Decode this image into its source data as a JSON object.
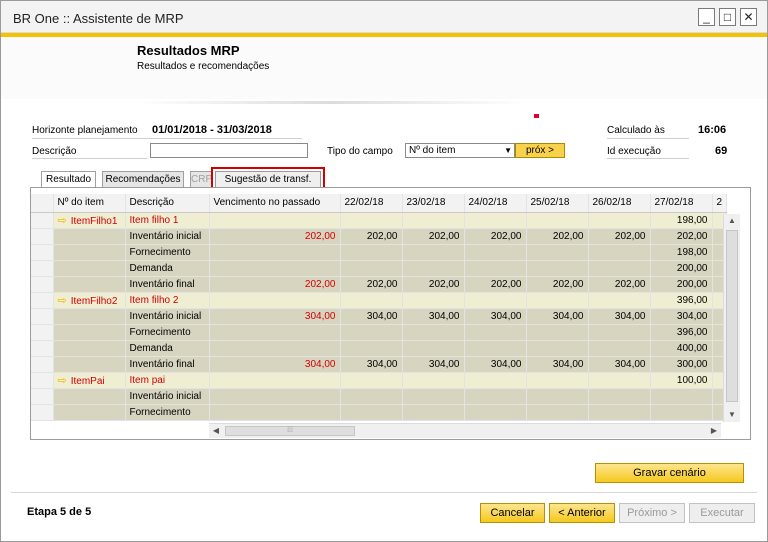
{
  "window": {
    "title": "BR One :: Assistente de MRP",
    "controls": {
      "minimize": "_",
      "maximize": "□",
      "close": "✕"
    }
  },
  "header": {
    "title": "Resultados MRP",
    "subtitle": "Resultados e recomendações"
  },
  "form": {
    "horizonte_label": "Horizonte planejamento",
    "horizonte_value": "01/01/2018 - 31/03/2018",
    "descricao_label": "Descrição",
    "descricao_value": "",
    "tipo_campo_label": "Tipo do campo",
    "tipo_campo_value": "Nº do item",
    "prox_button": "próx >",
    "calculado_label": "Calculado às",
    "calculado_value": "16:06",
    "id_execucao_label": "Id execução",
    "id_execucao_value": "69"
  },
  "tabs": [
    "Resultado",
    "Recomendações",
    "CRP",
    "Sugestão de transf."
  ],
  "grid": {
    "columns": [
      "Nº do item",
      "Descrição",
      "Vencimento no passado",
      "22/02/18",
      "23/02/18",
      "24/02/18",
      "25/02/18",
      "26/02/18",
      "27/02/18",
      "2"
    ],
    "rows": [
      {
        "type": "item",
        "item": "ItemFilho1",
        "desc": "Item filho 1",
        "past": "",
        "v": [
          "",
          "",
          "",
          "",
          "",
          "198,00"
        ]
      },
      {
        "type": "sub",
        "item": "",
        "desc": "Inventário inicial",
        "past": "202,00",
        "v": [
          "202,00",
          "202,00",
          "202,00",
          "202,00",
          "202,00",
          "202,00"
        ]
      },
      {
        "type": "sub",
        "item": "",
        "desc": "Fornecimento",
        "past": "",
        "v": [
          "",
          "",
          "",
          "",
          "",
          "198,00"
        ]
      },
      {
        "type": "sub",
        "item": "",
        "desc": "Demanda",
        "past": "",
        "v": [
          "",
          "",
          "",
          "",
          "",
          "200,00"
        ]
      },
      {
        "type": "sub",
        "item": "",
        "desc": "Inventário final",
        "past": "202,00",
        "v": [
          "202,00",
          "202,00",
          "202,00",
          "202,00",
          "202,00",
          "200,00"
        ]
      },
      {
        "type": "item",
        "item": "ItemFilho2",
        "desc": "Item filho 2",
        "past": "",
        "v": [
          "",
          "",
          "",
          "",
          "",
          "396,00"
        ]
      },
      {
        "type": "sub",
        "item": "",
        "desc": "Inventário inicial",
        "past": "304,00",
        "v": [
          "304,00",
          "304,00",
          "304,00",
          "304,00",
          "304,00",
          "304,00"
        ]
      },
      {
        "type": "sub",
        "item": "",
        "desc": "Fornecimento",
        "past": "",
        "v": [
          "",
          "",
          "",
          "",
          "",
          "396,00"
        ]
      },
      {
        "type": "sub",
        "item": "",
        "desc": "Demanda",
        "past": "",
        "v": [
          "",
          "",
          "",
          "",
          "",
          "400,00"
        ]
      },
      {
        "type": "sub",
        "item": "",
        "desc": "Inventário final",
        "past": "304,00",
        "v": [
          "304,00",
          "304,00",
          "304,00",
          "304,00",
          "304,00",
          "300,00"
        ]
      },
      {
        "type": "item",
        "item": "ItemPai",
        "desc": "Item pai",
        "past": "",
        "v": [
          "",
          "",
          "",
          "",
          "",
          "100,00"
        ]
      },
      {
        "type": "sub",
        "item": "",
        "desc": "Inventário inicial",
        "past": "",
        "v": [
          "",
          "",
          "",
          "",
          "",
          ""
        ]
      },
      {
        "type": "sub",
        "item": "",
        "desc": "Fornecimento",
        "past": "",
        "v": [
          "",
          "",
          "",
          "",
          "",
          ""
        ]
      }
    ]
  },
  "buttons": {
    "gravar": "Gravar cenário",
    "cancelar": "Cancelar",
    "anterior": "< Anterior",
    "proximo": "Próximo >",
    "executar": "Executar"
  },
  "footer": {
    "step": "Etapa 5 de 5"
  },
  "colors": {
    "accent": "#f5c200",
    "highlight": "#d40000",
    "item_row": "#efedd2",
    "sub_row": "#d7d4bf",
    "red_text": "#d20000"
  }
}
